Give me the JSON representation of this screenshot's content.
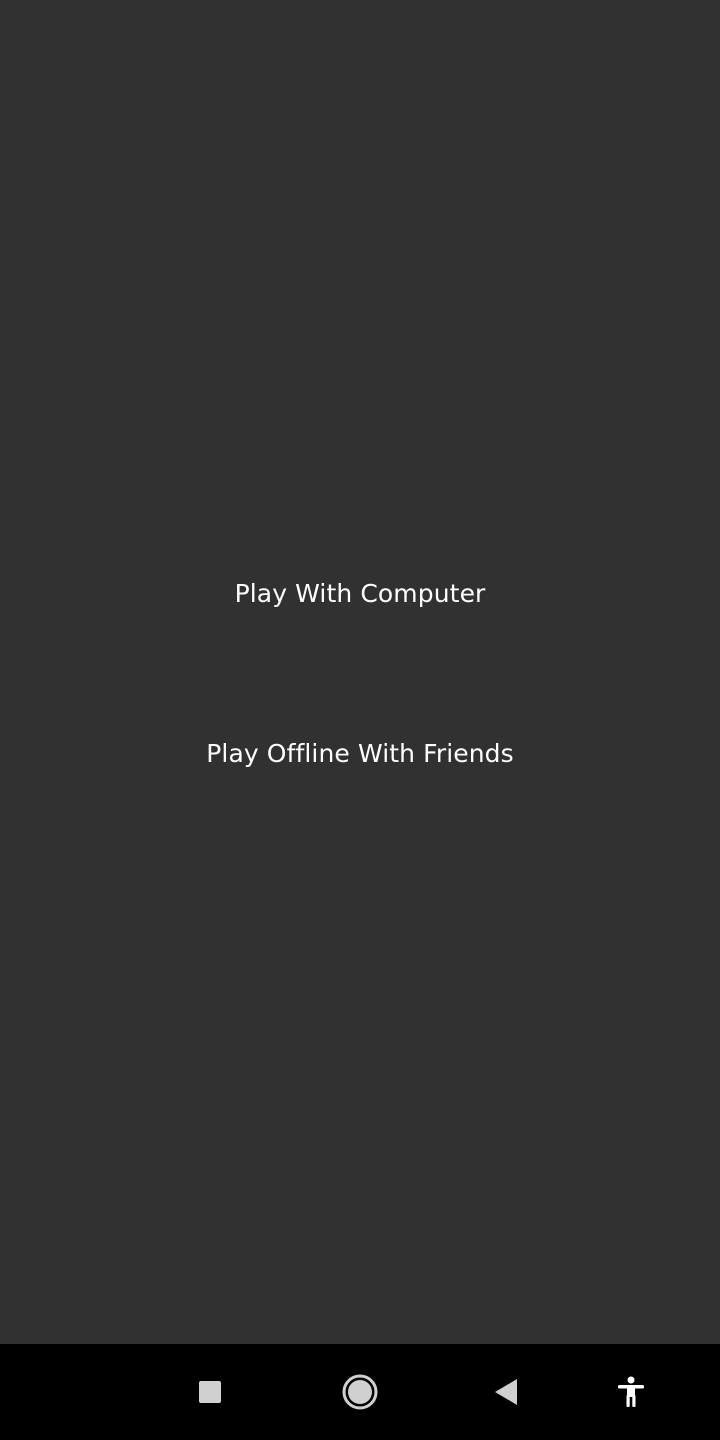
{
  "menu": {
    "play_computer_label": "Play With Computer",
    "play_friends_label": "Play Offline With Friends"
  },
  "navbar": {
    "icons": [
      "recents-icon",
      "home-icon",
      "back-icon",
      "accessibility-icon"
    ]
  },
  "colors": {
    "background": "#313131",
    "text": "#ffffff",
    "navbar": "#000000",
    "nav_icon": "#d0d0d0"
  }
}
